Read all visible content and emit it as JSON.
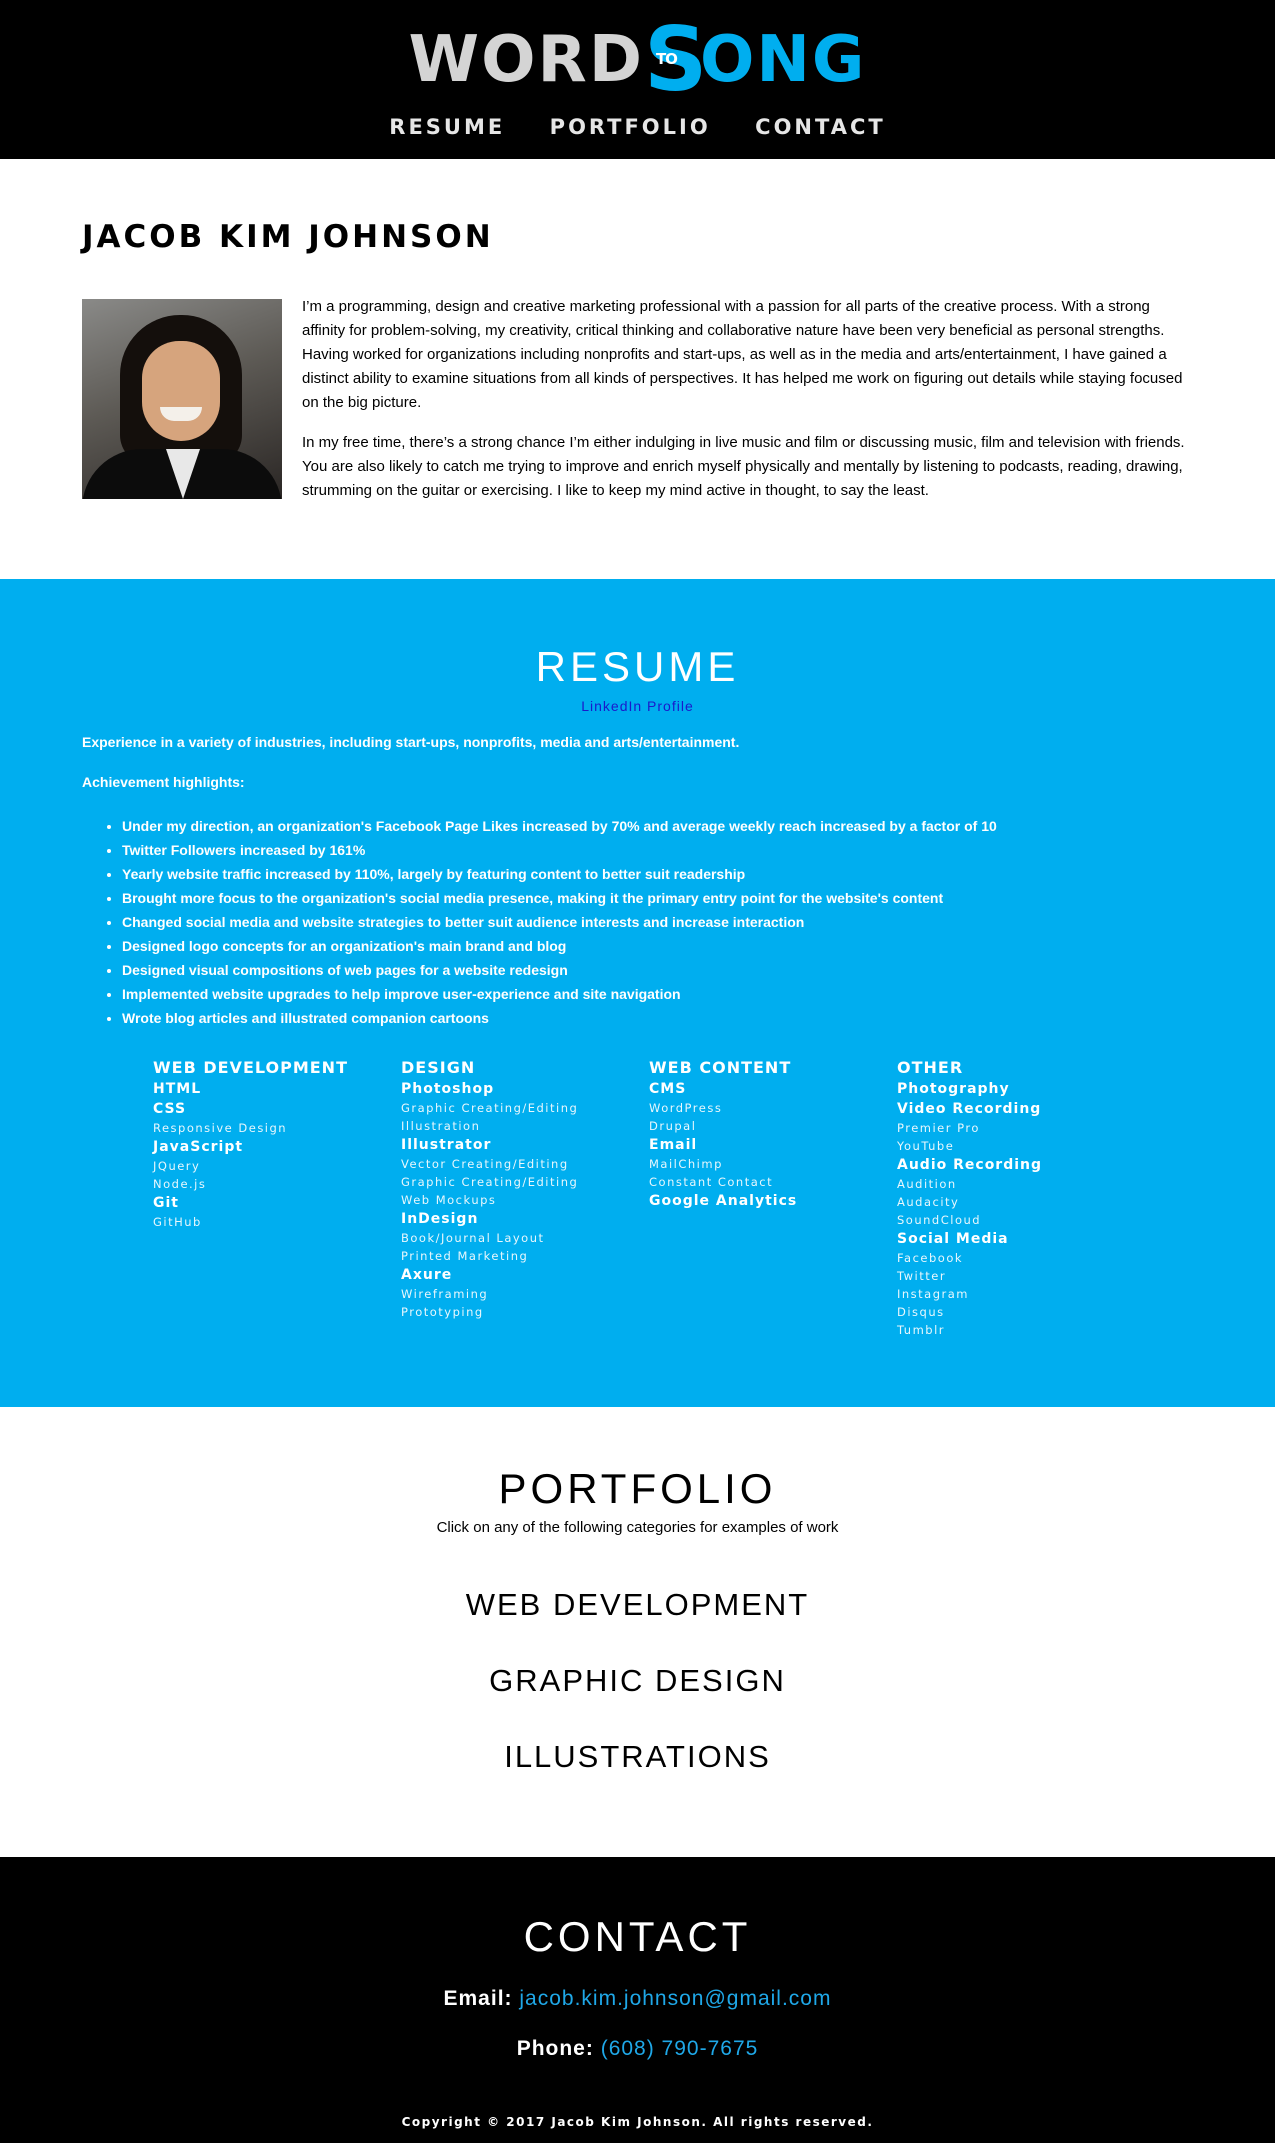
{
  "header": {
    "logo": {
      "word1": "WORD",
      "to": "TO",
      "s": "S",
      "word2": "ONG"
    },
    "nav": [
      {
        "label": "RESUME"
      },
      {
        "label": "PORTFOLIO"
      },
      {
        "label": "CONTACT"
      }
    ]
  },
  "about": {
    "name": "JACOB KIM JOHNSON",
    "paragraphs": [
      "I’m a programming, design and creative marketing professional with a passion for all parts of the creative process. With a strong affinity for problem-solving, my creativity, critical thinking and collaborative nature have been very beneficial as personal strengths. Having worked for organizations including nonprofits and start-ups, as well as in the media and arts/entertainment, I have gained a distinct ability to examine situations from all kinds of perspectives. It has helped me work on figuring out details while staying focused on the big picture.",
      "In my free time, there’s a strong chance I’m either indulging in live music and film or discussing music, film and television with friends. You are also likely to catch me trying to improve and enrich myself physically and mentally by listening to podcasts, reading, drawing, strumming on the guitar or exercising. I like to keep my mind active in thought, to say the least."
    ]
  },
  "resume": {
    "title": "RESUME",
    "linkedin": "LinkedIn Profile",
    "intro": "Experience in a variety of industries, including start-ups, nonprofits, media and arts/entertainment.",
    "highlights_title": "Achievement highlights:",
    "highlights": [
      "Under my direction, an organization's Facebook Page Likes increased by 70% and average weekly reach increased by a factor of 10",
      "Twitter Followers increased by 161%",
      "Yearly website traffic increased by 110%, largely by featuring content to better suit readership",
      "Brought more focus to the organization's social media presence, making it the primary entry point for the website's content",
      "Changed social media and website strategies to better suit audience interests and increase interaction",
      "Designed logo concepts for an organization's main brand and blog",
      "Designed visual compositions of web pages for a website redesign",
      "Implemented website upgrades to help improve user-experience and site navigation",
      "Wrote blog articles and illustrated companion cartoons"
    ],
    "columns": [
      {
        "title": "WEB DEVELOPMENT",
        "groups": [
          {
            "name": "HTML",
            "items": []
          },
          {
            "name": "CSS",
            "items": [
              "Responsive Design"
            ]
          },
          {
            "name": "JavaScript",
            "items": [
              "JQuery",
              "Node.js"
            ]
          },
          {
            "name": "Git",
            "items": [
              "GitHub"
            ]
          }
        ]
      },
      {
        "title": "DESIGN",
        "groups": [
          {
            "name": "Photoshop",
            "items": [
              "Graphic Creating/Editing",
              "Illustration"
            ]
          },
          {
            "name": "Illustrator",
            "items": [
              "Vector Creating/Editing",
              "Graphic Creating/Editing",
              "Web Mockups"
            ]
          },
          {
            "name": "InDesign",
            "items": [
              "Book/Journal Layout",
              "Printed Marketing"
            ]
          },
          {
            "name": "Axure",
            "items": [
              "Wireframing",
              "Prototyping"
            ]
          }
        ]
      },
      {
        "title": "WEB CONTENT",
        "groups": [
          {
            "name": "CMS",
            "items": [
              "WordPress",
              "Drupal"
            ]
          },
          {
            "name": "Email",
            "items": [
              "MailChimp",
              "Constant Contact"
            ]
          },
          {
            "name": "Google Analytics",
            "items": []
          }
        ]
      },
      {
        "title": "OTHER",
        "groups": [
          {
            "name": "Photography",
            "items": []
          },
          {
            "name": "Video Recording",
            "items": [
              "Premier Pro",
              "YouTube"
            ]
          },
          {
            "name": "Audio Recording",
            "items": [
              "Audition",
              "Audacity",
              "SoundCloud"
            ]
          },
          {
            "name": "Social Media",
            "items": [
              "Facebook",
              "Twitter",
              "Instagram",
              "Disqus",
              "Tumblr"
            ]
          }
        ]
      }
    ]
  },
  "portfolio": {
    "title": "PORTFOLIO",
    "subtitle": "Click on any of the following categories for examples of work",
    "categories": [
      "WEB DEVELOPMENT",
      "GRAPHIC DESIGN",
      "ILLUSTRATIONS"
    ]
  },
  "contact": {
    "title": "CONTACT",
    "email_label": "Email:",
    "email": "jacob.kim.johnson@gmail.com",
    "phone_label": "Phone:",
    "phone": "(608) 790-7675",
    "copyright": "Copyright © 2017 Jacob Kim Johnson. All rights reserved."
  },
  "colors": {
    "accent": "#00aeef",
    "header_bg": "#000000",
    "link": "#1a1acb",
    "contact_link": "#1fa8e8"
  }
}
